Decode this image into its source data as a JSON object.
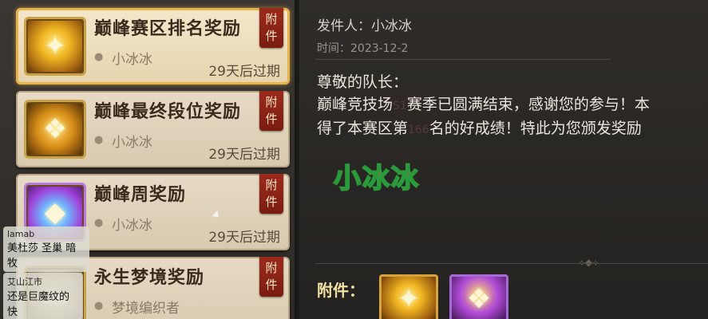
{
  "mails": [
    {
      "title": "巅峰赛区排名奖励",
      "sender": "小冰冰",
      "expire": "29天后过期",
      "tag": "附件",
      "icon": "gold-chest-icon",
      "selected": true
    },
    {
      "title": "巅峰最终段位奖励",
      "sender": "小冰冰",
      "expire": "29天后过期",
      "tag": "附件",
      "icon": "card-icon",
      "selected": false
    },
    {
      "title": "巅峰周奖励",
      "sender": "小冰冰",
      "expire": "29天后过期",
      "tag": "附件",
      "icon": "crystal-icon",
      "selected": false
    },
    {
      "title": "永生梦境奖励",
      "sender": "梦境编织者",
      "expire": "",
      "tag": "附件",
      "icon": "dream-icon",
      "selected": false
    }
  ],
  "chat": [
    {
      "name": "lamab",
      "text": "美杜莎 圣巢 暗牧"
    },
    {
      "name": "艾山江市",
      "text": "还是巨魔纹的快"
    }
  ],
  "detail": {
    "sender": "发件人：小冰冰",
    "time": "时间：2023-12-2",
    "greeting": "尊敬的队长：",
    "body1_a": "巅峰竞技场",
    "body1_faded": "S1",
    "body1_b": "赛季已圆满结束，感谢您的参与！本",
    "body2_a": "得了本赛区第",
    "body2_faded": "166",
    "body2_b": "名的好成绩！特此为您颁发奖励",
    "watermark": "小冰冰",
    "attach_label": "附件："
  }
}
